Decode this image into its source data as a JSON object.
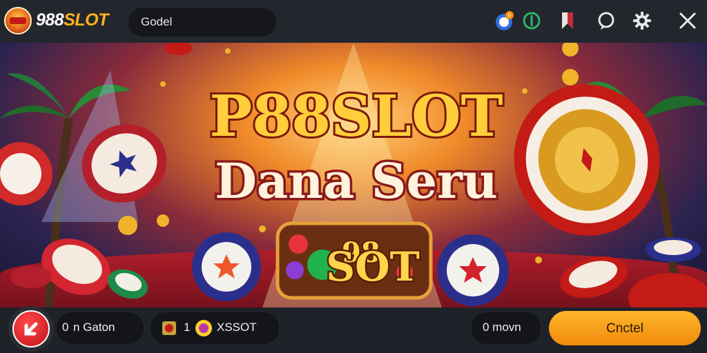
{
  "header": {
    "logo_text_prefix": "988",
    "logo_text_suffix": "SLOT",
    "search_value": "Godel",
    "icons": [
      "notification-icon",
      "shield-icon",
      "bookmark-icon",
      "chat-icon",
      "gear-icon",
      "close-icon"
    ],
    "notification_count": "6"
  },
  "hero": {
    "title_line1": "P88SLOT",
    "title_line2": "Dana Seru",
    "badge_text": "SOT",
    "badge_prefix": "98",
    "colors": {
      "gold": "#ffb21a",
      "red": "#c41b16",
      "navy": "#2b2f8c"
    }
  },
  "footer": {
    "left_pill_prefix": "0",
    "left_pill_label": "n Gaton",
    "middle_pill_count": "1",
    "middle_pill_label": "XSSOT",
    "right_pill_label": "0 movn",
    "cancel_label": "Cnctel"
  }
}
